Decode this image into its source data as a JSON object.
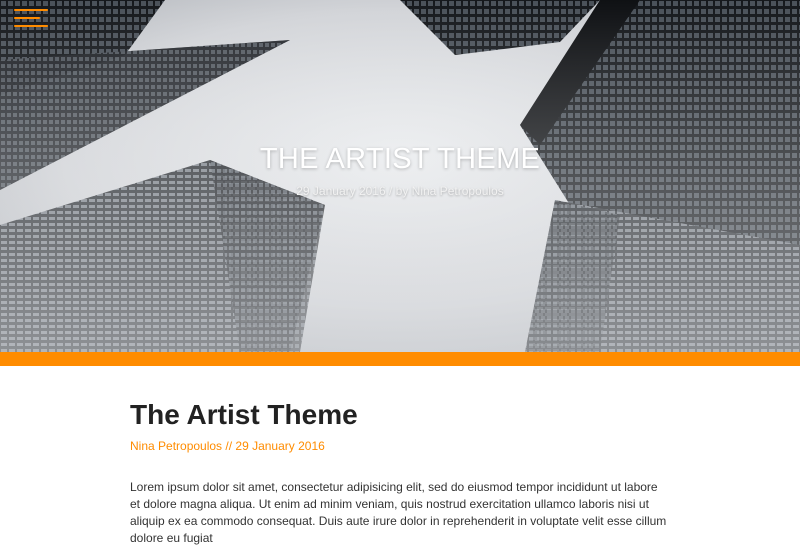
{
  "hero": {
    "title": "THE ARTIST THEME",
    "date": "29 January 2016",
    "separator": " / by ",
    "author": "Nina Petropoulos"
  },
  "menu": {
    "icon": "hamburger-menu-icon"
  },
  "post": {
    "title": "The Artist Theme",
    "author": "Nina Petropoulos",
    "separator": " // ",
    "date": "29 January 2016",
    "body": "Lorem ipsum dolor sit amet, consectetur adipisicing elit, sed do eiusmod tempor incididunt ut labore et dolore magna aliqua. Ut enim ad minim veniam, quis nostrud exercitation ullamco laboris nisi ut aliquip ex ea commodo consequat. Duis aute irure dolor in reprehenderit in voluptate velit esse cillum dolore eu fugiat"
  },
  "colors": {
    "accent": "#ff8c00",
    "title": "#222222",
    "text": "#333333"
  }
}
